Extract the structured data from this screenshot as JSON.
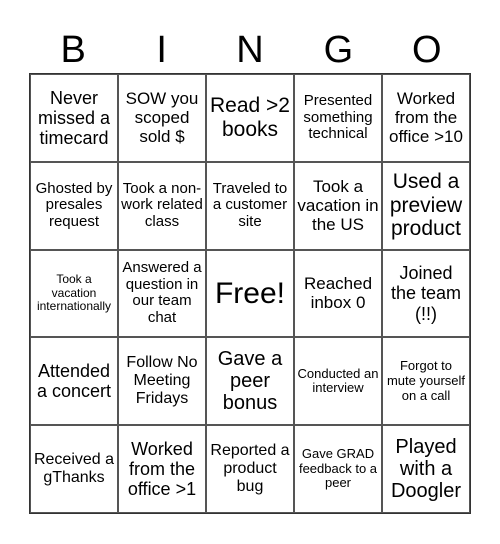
{
  "header": {
    "letters": [
      "B",
      "I",
      "N",
      "G",
      "O"
    ]
  },
  "cells": [
    "Never missed a timecard",
    "SOW you scoped sold $",
    "Read >2 books",
    "Presented something technical",
    "Worked from the office >10",
    "Ghosted by presales request",
    "Took a non-work related class",
    "Traveled to a customer site",
    "Took a vacation in the US",
    "Used a preview product",
    "Took a vacation internationally",
    "Answered a question in our team chat",
    "Free!",
    "Reached inbox 0",
    "Joined the team (!!)",
    "Attended a concert",
    "Follow No Meeting Fridays",
    "Gave a peer bonus",
    "Conducted an interview",
    "Forgot to mute yourself on a call",
    "Received a gThanks",
    "Worked from the office >1",
    "Reported a product bug",
    "Gave GRAD feedback to a peer",
    "Played with a Doogler"
  ]
}
